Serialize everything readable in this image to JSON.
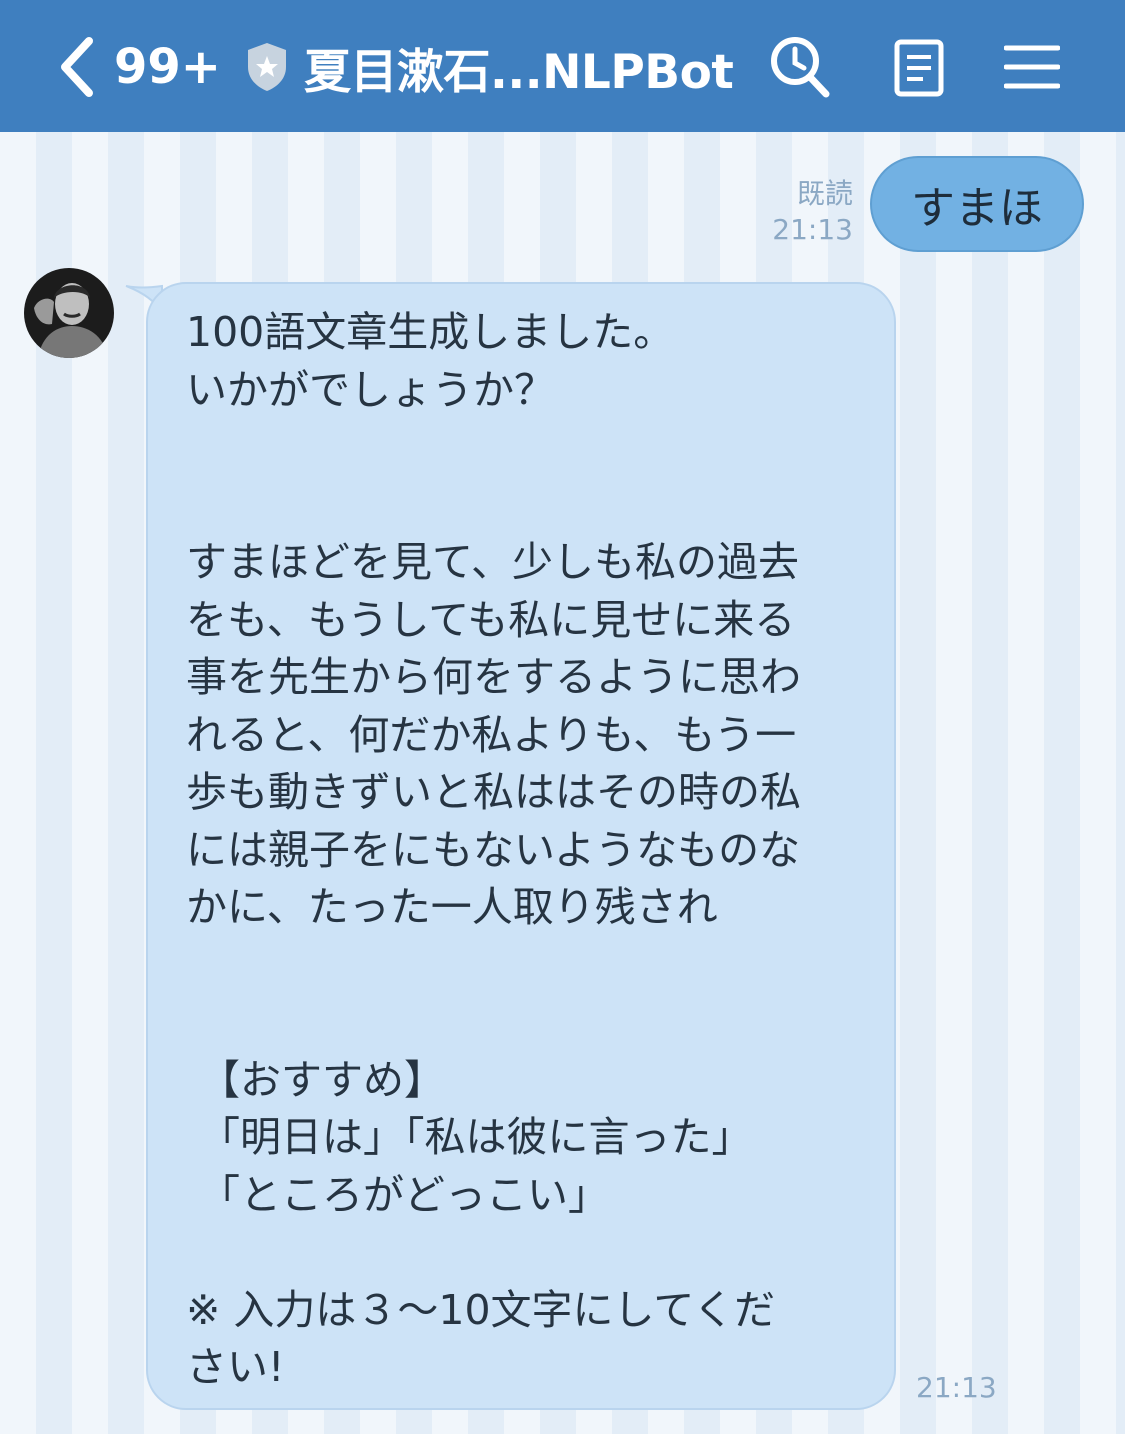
{
  "header": {
    "unread_count": "99+",
    "title": "夏目漱石...NLPBot"
  },
  "messages": {
    "outgoing": {
      "text": "すまほ",
      "read_label": "既読",
      "time": "21:13"
    },
    "incoming": {
      "text": "100語文章生成しました。\nいかがでしょうか？\n\n\nすまほどを見て、少しも私の過去\nをも、もうしても私に見せに来る\n事を先生から何をするように思わ\nれると、何だか私よりも、もう一\n歩も動きずいと私ははその時の私\nには親子をにもないようなものな\nかに、たった一人取り残され\n\n\n 【おすすめ】\n 「明日は」「私は彼に言った」\n 「ところがどっこい」\n\n※ 入力は３～10文字にしてくだ\nさい!",
      "time": "21:13"
    }
  },
  "colors": {
    "header_bg": "#3f7fbf",
    "outgoing_bubble": "#72b1e3",
    "incoming_bubble": "#cde3f7"
  },
  "icons": [
    "chevron-left-icon",
    "shield-star-icon",
    "search-icon",
    "notes-icon",
    "hamburger-menu-icon"
  ]
}
